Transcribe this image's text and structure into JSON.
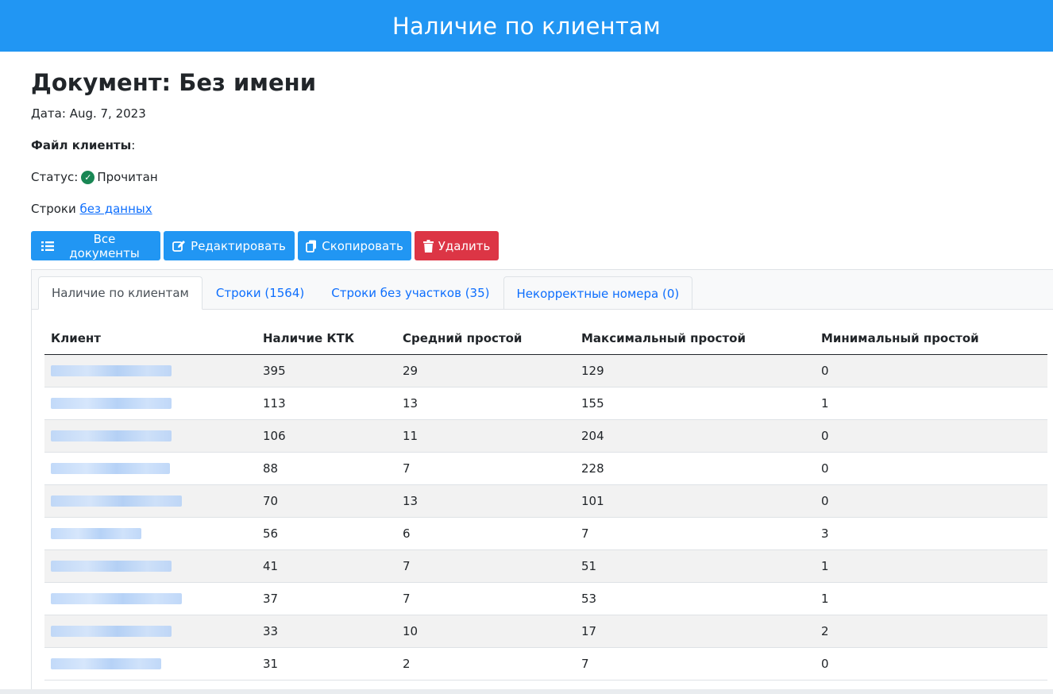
{
  "header": {
    "title": "Наличие по клиентам"
  },
  "document": {
    "title": "Документ: Без имени",
    "date_label": "Дата:",
    "date_value": "Aug. 7, 2023",
    "file_label": "Файл клиенты",
    "file_colon": ":",
    "status_label": "Статус:",
    "status_value": "Прочитан",
    "rows_label": "Строки",
    "rows_link": "без данных"
  },
  "toolbar": {
    "all_docs": "Все документы",
    "edit": "Редактировать",
    "copy": "Скопировать",
    "delete": "Удалить",
    "colors": {
      "primary": "#2196f3",
      "danger": "#dc3545",
      "success": "#198754"
    }
  },
  "tabs": [
    {
      "label": "Наличие по клиентам",
      "active": true
    },
    {
      "label": "Строки (1564)",
      "active": false
    },
    {
      "label": "Строки без участков (35)",
      "active": false
    },
    {
      "label": "Некорректные номера (0)",
      "active": false
    }
  ],
  "table": {
    "headers": [
      "Клиент",
      "Наличие КТК",
      "Средний простой",
      "Максимальный простой",
      "Минимальный простой"
    ],
    "rows": [
      {
        "client": "",
        "ktk": "395",
        "avg": "29",
        "max": "129",
        "min": "0"
      },
      {
        "client": "",
        "ktk": "113",
        "avg": "13",
        "max": "155",
        "min": "1"
      },
      {
        "client": "",
        "ktk": "106",
        "avg": "11",
        "max": "204",
        "min": "0"
      },
      {
        "client": "",
        "ktk": "88",
        "avg": "7",
        "max": "228",
        "min": "0"
      },
      {
        "client": "",
        "ktk": "70",
        "avg": "13",
        "max": "101",
        "min": "0"
      },
      {
        "client": "",
        "ktk": "56",
        "avg": "6",
        "max": "7",
        "min": "3"
      },
      {
        "client": "",
        "ktk": "41",
        "avg": "7",
        "max": "51",
        "min": "1"
      },
      {
        "client": "",
        "ktk": "37",
        "avg": "7",
        "max": "53",
        "min": "1"
      },
      {
        "client": "",
        "ktk": "33",
        "avg": "10",
        "max": "17",
        "min": "2"
      },
      {
        "client": "",
        "ktk": "31",
        "avg": "2",
        "max": "7",
        "min": "0"
      }
    ]
  }
}
